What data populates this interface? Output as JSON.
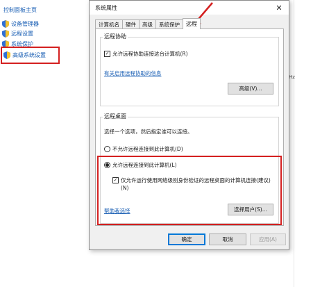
{
  "background": {
    "home_link": "控制面板主页",
    "nav_items": [
      {
        "label": "设备管理器",
        "icon": "shield-icon"
      },
      {
        "label": "远程设置",
        "icon": "shield-icon"
      },
      {
        "label": "系统保护",
        "icon": "shield-icon"
      },
      {
        "label": "高级系统设置",
        "icon": "shield-icon"
      }
    ],
    "right_fragment": "Hz"
  },
  "dialog": {
    "title": "系统属性",
    "close_glyph": "✕",
    "tabs": [
      {
        "label": "计算机名"
      },
      {
        "label": "硬件"
      },
      {
        "label": "高级"
      },
      {
        "label": "系统保护"
      },
      {
        "label": "远程"
      }
    ],
    "remote_assistance": {
      "title": "远程协助",
      "allow_checkbox": "允许远程协助连接这台计算机(R)",
      "allow_checked": true,
      "info_link": "有关启用远程协助的信息",
      "advanced_button": "高级(V)..."
    },
    "remote_desktop": {
      "title": "远程桌面",
      "instruction": "选择一个选项，然后指定谁可以连接。",
      "option_deny": "不允许远程连接到此计算机(D)",
      "option_allow": "允许远程连接到此计算机(L)",
      "nla_checkbox_line1": "仅允许运行使用网络级别身份验证的远程桌面的计算机连接(建议)",
      "nla_checkbox_line2": "(N)",
      "nla_checked": true,
      "help_link": "帮助我选择",
      "select_users_button": "选择用户(S)..."
    },
    "buttons": {
      "ok": "确定",
      "cancel": "取消",
      "apply": "应用(A)"
    }
  },
  "colors": {
    "highlight_red": "#d42020",
    "link_blue": "#1a5fb4",
    "accent_blue": "#0078d7"
  }
}
